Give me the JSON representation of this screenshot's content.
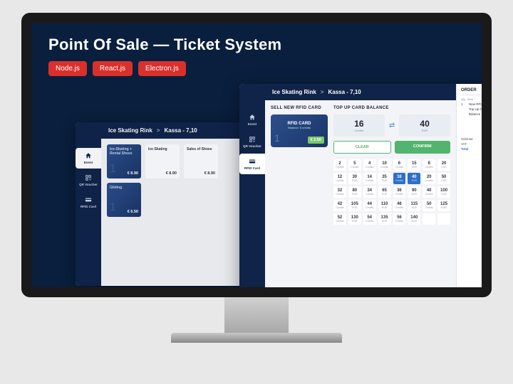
{
  "hero": {
    "title": "Point Of Sale — Ticket System",
    "tags": [
      "Node.js",
      "React.js",
      "Electron.js"
    ]
  },
  "breadcrumb": {
    "root": "Ice Skating Rink",
    "sep": ">",
    "loc": "Kassa - 7,10"
  },
  "sidebar": [
    {
      "label": "Event",
      "icon": "home"
    },
    {
      "label": "QR Voucher",
      "icon": "qr"
    },
    {
      "label": "RFID Card",
      "icon": "card"
    }
  ],
  "backTiles": [
    {
      "name": "Ice-Skating + Rental Shoes",
      "qty": "1",
      "price": "€ 8.90",
      "blue": true
    },
    {
      "name": "Ice-Skating",
      "qty": "",
      "price": "€ 8.90"
    },
    {
      "name": "Sales of Shoes",
      "qty": "",
      "price": "€ 8.90"
    },
    {
      "name": "Gliding",
      "qty": "1",
      "price": "€ 6.50",
      "blue": true
    }
  ],
  "sell": {
    "title": "SELL NEW RFID CARD",
    "card": {
      "name": "RFID CARD",
      "sub": "Balance: 6 credits",
      "qty": "1",
      "price": "€ 2.50"
    }
  },
  "topup": {
    "title": "TOP UP CARD BALANCE",
    "left": {
      "n": "16",
      "s": "Credits"
    },
    "right": {
      "n": "40",
      "s": "EUR"
    },
    "clear": "CLEAR",
    "confirm": "CONFIRM",
    "grid": [
      {
        "n": "2",
        "s": "Credits"
      },
      {
        "n": "5",
        "s": "Credits"
      },
      {
        "n": "4",
        "s": "Credits"
      },
      {
        "n": "10",
        "s": "Credits"
      },
      {
        "n": "6",
        "s": "Credits"
      },
      {
        "n": "15",
        "s": "EUR"
      },
      {
        "n": "8",
        "s": "Credits"
      },
      {
        "n": "20",
        "s": "EUR"
      },
      {
        "n": "12",
        "s": "Credits"
      },
      {
        "n": "30",
        "s": "EUR"
      },
      {
        "n": "14",
        "s": "Credits"
      },
      {
        "n": "35",
        "s": "EUR"
      },
      {
        "n": "16",
        "s": "Credits",
        "on": true
      },
      {
        "n": "40",
        "s": "EUR",
        "on": true
      },
      {
        "n": "20",
        "s": "Credits"
      },
      {
        "n": "50",
        "s": "EUR"
      },
      {
        "n": "32",
        "s": "Credits"
      },
      {
        "n": "80",
        "s": "EUR"
      },
      {
        "n": "34",
        "s": "Credits"
      },
      {
        "n": "65",
        "s": "EUR"
      },
      {
        "n": "36",
        "s": "Credits"
      },
      {
        "n": "90",
        "s": "EUR"
      },
      {
        "n": "40",
        "s": "Credits"
      },
      {
        "n": "100",
        "s": "EUR"
      },
      {
        "n": "42",
        "s": "Credits"
      },
      {
        "n": "105",
        "s": "EUR"
      },
      {
        "n": "44",
        "s": "Credits"
      },
      {
        "n": "110",
        "s": "EUR"
      },
      {
        "n": "46",
        "s": "Credits"
      },
      {
        "n": "115",
        "s": "EUR"
      },
      {
        "n": "50",
        "s": "Credits"
      },
      {
        "n": "125",
        "s": "EUR"
      },
      {
        "n": "52",
        "s": "Credits"
      },
      {
        "n": "130",
        "s": "EUR"
      },
      {
        "n": "54",
        "s": "Credits"
      },
      {
        "n": "135",
        "s": "EUR"
      },
      {
        "n": "56",
        "s": "Credits"
      },
      {
        "n": "140",
        "s": "EUR"
      },
      {
        "n": "",
        "s": ""
      },
      {
        "n": "",
        "s": ""
      }
    ]
  },
  "order": {
    "title": "ORDER",
    "cols": [
      "Qty",
      "Item"
    ],
    "lines": [
      {
        "q": "1",
        "n": "New RFID C"
      },
      {
        "q": "",
        "n": "Top Up Car"
      },
      {
        "q": "",
        "n": "Balance"
      }
    ],
    "subtotal": "Subtotal",
    "vat": "VAT",
    "total": "Total"
  }
}
